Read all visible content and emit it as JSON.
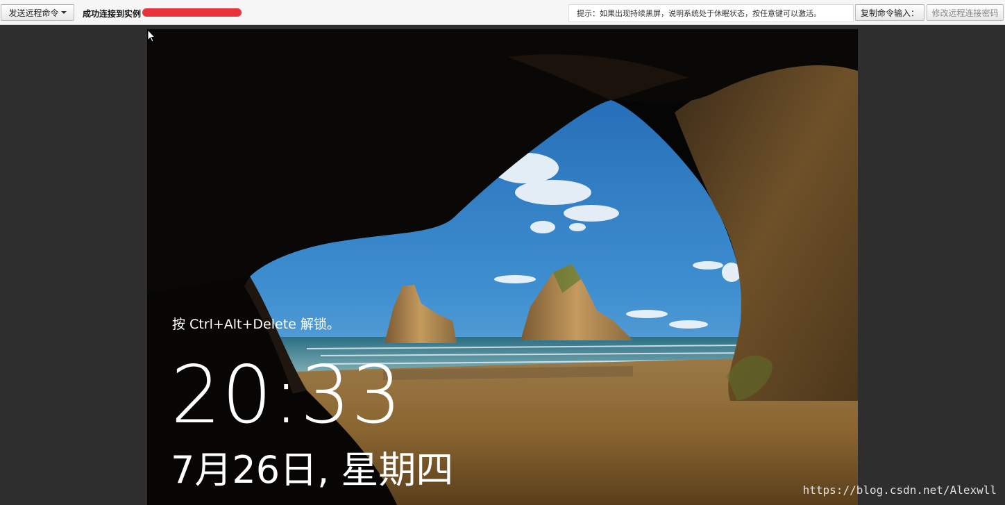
{
  "toolbar": {
    "send_command_label": "发送远程命令",
    "send_command_caret": "chevron-down-icon",
    "status_text": "成功连接到实例",
    "tip_text": "提示：如果出现持续黑屏，说明系统处于休眠状态，按任意键可以激活。",
    "copy_command_label": "复制命令输入：",
    "change_password_label": "修改远程连接密码"
  },
  "lockscreen": {
    "hint": "按 Ctrl+Alt+Delete 解锁。",
    "time": "20:33",
    "date": "7月26日, 星期四"
  },
  "watermark": "https://blog.csdn.net/Alexwll",
  "colors": {
    "toolbar_bg": "#f6f6f6",
    "page_bg": "#2e2e2e",
    "redaction": "#e8333d",
    "sky": "#2f7fc4",
    "sand": "#8a6530"
  }
}
